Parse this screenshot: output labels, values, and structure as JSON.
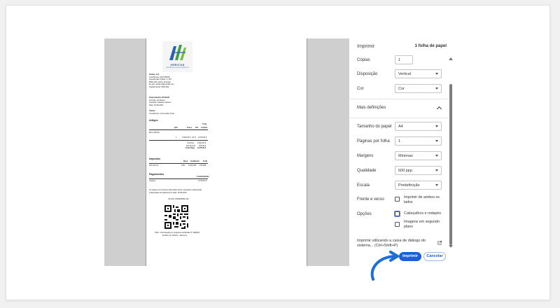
{
  "print_panel": {
    "title": "Imprimir",
    "sheets": "1 folha de papel",
    "copies_label": "Cópias",
    "copies_value": "1",
    "layout_label": "Disposição",
    "layout_value": "Vertical",
    "color_label": "Cor",
    "color_value": "Cor",
    "more_settings": "Mais definições",
    "paper_size_label": "Tamanho do papel",
    "paper_size_value": "A4",
    "pages_per_sheet_label": "Páginas por folha",
    "pages_per_sheet_value": "1",
    "margins_label": "Margens",
    "margins_value": "Mínimas",
    "quality_label": "Qualidade",
    "quality_value": "600 ppp",
    "scale_label": "Escala",
    "scale_value": "Predefinição",
    "duplex_label": "Frente e verso",
    "duplex_option": "Imprimir de ambos os lados",
    "options_label": "Opções",
    "headers_footers": "Cabeçalhos e rodapés",
    "background_images": "Imagens em segundo plano",
    "system_dialog": "Imprimir utilizando a caixa de diálogo do sistema... (Ctrl+Shift+P)",
    "print_button": "Imprimir",
    "cancel_button": "Cancelar"
  },
  "colors": {
    "accent": "#1a61d8",
    "arrow": "#1c6fd6",
    "preview_bg": "#cfcfcf"
  },
  "invoice": {
    "logo_text": "VERITAS",
    "logo_subtext": "VERITAS SOLUÇÕES E SERVIÇOS",
    "company": "Veritas, S.A.",
    "contribuinte": "Contribuinte: 5112345678",
    "address": "Avenida das Túlipas, nº 567",
    "city": "8000-123 Lisboa, Portugal",
    "email": "E-mail: veritas.sa@veritas.com",
    "capital": "Capital Social: 5000,00€",
    "doc_title": "Fatura Recibo FR B/123",
    "doc_original": "Formato: Ferradura",
    "doc_operator": "Operador: Maskar Casteiro",
    "doc_date": "Data: 16-08-2024",
    "client_label": "Cliente",
    "client_name": "Contribuinte: Consumidor Final",
    "items_heading": "Artigos",
    "col_qty": "Qtd",
    "col_price": "Preço",
    "col_iva": "IVA",
    "col_total_header": "Total",
    "col_total": "Líquido",
    "item_name": "Bico Artificial",
    "item_qty": "1",
    "item_price": "2.500,00 €",
    "item_iva": "23 %",
    "item_total": "3.075,00 €",
    "subtotal_label": "Total Ilíq.",
    "subtotal_value": "2.500,00 €",
    "iva_label": "IVA Normal",
    "iva_value": "575,00 €",
    "total_label": "Total Pago",
    "total_value": "3.075,00 €",
    "taxes_heading": "Impostos",
    "tax_col_base": "Base",
    "tax_col_rate": "Incidência",
    "tax_col_total": "Total",
    "tax_name": "IVA Normal",
    "tax_rate": "23%",
    "tax_base": "2.500,00€",
    "tax_total": "575,00€",
    "payments_heading": "Pagamentos",
    "payments_col": "Crédito/Débito",
    "payment_method": "Cheque",
    "payment_value": "3.075,00 €",
    "legal_1": "Os artigos e/ou Serviços Mercados foram colocados à disposição",
    "legal_2": "à disposição do adquirente a data: 16-08-2024",
    "atcud": "ATCUD: FR/9999999-123",
    "footer_1": "0434 - Processado por programa certificado Nº 9999/AT",
    "footer_2": "Emitido por Sitiauto - faturar.pt"
  }
}
